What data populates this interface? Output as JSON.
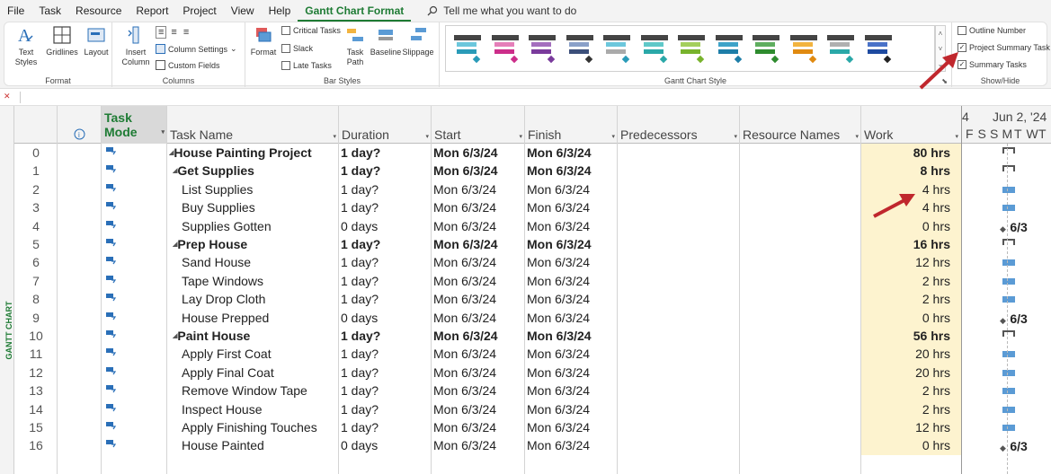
{
  "menu": {
    "items": [
      "File",
      "Task",
      "Resource",
      "Report",
      "Project",
      "View",
      "Help",
      "Gantt Chart Format"
    ],
    "active": "Gantt Chart Format",
    "tell_me": "Tell me what you want to do"
  },
  "ribbon": {
    "format_group": {
      "label": "Format",
      "text_styles": "Text Styles",
      "gridlines": "Gridlines",
      "layout": "Layout"
    },
    "columns_group": {
      "label": "Columns",
      "insert_column": "Insert Column",
      "column_settings": "Column Settings",
      "custom_fields": "Custom Fields"
    },
    "bar_styles_group": {
      "label": "Bar Styles",
      "format": "Format",
      "critical_tasks": "Critical Tasks",
      "slack": "Slack",
      "late_tasks": "Late Tasks",
      "task_path": "Task Path",
      "baseline": "Baseline",
      "slippage": "Slippage"
    },
    "gantt_style_group": {
      "label": "Gantt Chart Style"
    },
    "show_hide_group": {
      "label": "Show/Hide",
      "outline_number": "Outline Number",
      "project_summary_task": "Project Summary Task",
      "summary_tasks": "Summary Tasks",
      "outline_number_checked": false,
      "project_summary_checked": true,
      "summary_tasks_checked": true
    }
  },
  "gantt_styles": [
    {
      "top": "#6cc7dc",
      "bottom": "#2a9bb8",
      "diamond": "#2a9bb8"
    },
    {
      "top": "#e57fb9",
      "bottom": "#cc2e8a",
      "diamond": "#cc2e8a"
    },
    {
      "top": "#a46fbe",
      "bottom": "#7a3b9c",
      "diamond": "#7a3b9c"
    },
    {
      "top": "#8aa0c8",
      "bottom": "#3c4f7a",
      "diamond": "#333333"
    },
    {
      "top": "#6cc7dc",
      "bottom": "#aaaaaa",
      "diamond": "#2a9bb8"
    },
    {
      "top": "#5fc8c8",
      "bottom": "#2aa8a8",
      "diamond": "#2aa8a8"
    },
    {
      "top": "#a4cf5c",
      "bottom": "#78b32c",
      "diamond": "#78b32c"
    },
    {
      "top": "#3ea3c8",
      "bottom": "#1e7ea8",
      "diamond": "#1e7ea8"
    },
    {
      "top": "#5fae5f",
      "bottom": "#2e8b2e",
      "diamond": "#2e8b2e"
    },
    {
      "top": "#f2b440",
      "bottom": "#e08a10",
      "diamond": "#e08a10"
    },
    {
      "top": "#b0b0b0",
      "bottom": "#2aa8a8",
      "diamond": "#2aa8a8"
    },
    {
      "top": "#4a72c8",
      "bottom": "#1e4aa0",
      "diamond": "#222222"
    }
  ],
  "side_label": "GANTT CHART",
  "columns": {
    "task_mode": "Task Mode",
    "task_name": "Task Name",
    "duration": "Duration",
    "start": "Start",
    "finish": "Finish",
    "predecessors": "Predecessors",
    "resource_names": "Resource Names",
    "work": "Work"
  },
  "timescale": {
    "prev": "4",
    "week": "Jun 2, '24",
    "days": [
      "F",
      "S",
      "S",
      "M",
      "T",
      "W",
      "T"
    ]
  },
  "tasks": [
    {
      "id": "0",
      "name": "House Painting Project",
      "duration": "1 day?",
      "start": "Mon 6/3/24",
      "finish": "Mon 6/3/24",
      "work": "80 hrs",
      "bold": true,
      "summary": true,
      "indent": 0,
      "bar": "summary"
    },
    {
      "id": "1",
      "name": "Get Supplies",
      "duration": "1 day?",
      "start": "Mon 6/3/24",
      "finish": "Mon 6/3/24",
      "work": "8 hrs",
      "bold": true,
      "summary": true,
      "indent": 1,
      "bar": "summary"
    },
    {
      "id": "2",
      "name": "List Supplies",
      "duration": "1 day?",
      "start": "Mon 6/3/24",
      "finish": "Mon 6/3/24",
      "work": "4 hrs",
      "bold": false,
      "summary": false,
      "indent": 2,
      "bar": "task"
    },
    {
      "id": "3",
      "name": "Buy Supplies",
      "duration": "1 day?",
      "start": "Mon 6/3/24",
      "finish": "Mon 6/3/24",
      "work": "4 hrs",
      "bold": false,
      "summary": false,
      "indent": 2,
      "bar": "task"
    },
    {
      "id": "4",
      "name": "Supplies Gotten",
      "duration": "0 days",
      "start": "Mon 6/3/24",
      "finish": "Mon 6/3/24",
      "work": "0 hrs",
      "bold": false,
      "summary": false,
      "indent": 2,
      "bar": "milestone",
      "milestone_label": "6/3"
    },
    {
      "id": "5",
      "name": "Prep House",
      "duration": "1 day?",
      "start": "Mon 6/3/24",
      "finish": "Mon 6/3/24",
      "work": "16 hrs",
      "bold": true,
      "summary": true,
      "indent": 1,
      "bar": "summary"
    },
    {
      "id": "6",
      "name": "Sand House",
      "duration": "1 day?",
      "start": "Mon 6/3/24",
      "finish": "Mon 6/3/24",
      "work": "12 hrs",
      "bold": false,
      "summary": false,
      "indent": 2,
      "bar": "task"
    },
    {
      "id": "7",
      "name": "Tape Windows",
      "duration": "1 day?",
      "start": "Mon 6/3/24",
      "finish": "Mon 6/3/24",
      "work": "2 hrs",
      "bold": false,
      "summary": false,
      "indent": 2,
      "bar": "task"
    },
    {
      "id": "8",
      "name": "Lay Drop Cloth",
      "duration": "1 day?",
      "start": "Mon 6/3/24",
      "finish": "Mon 6/3/24",
      "work": "2 hrs",
      "bold": false,
      "summary": false,
      "indent": 2,
      "bar": "task"
    },
    {
      "id": "9",
      "name": "House Prepped",
      "duration": "0 days",
      "start": "Mon 6/3/24",
      "finish": "Mon 6/3/24",
      "work": "0 hrs",
      "bold": false,
      "summary": false,
      "indent": 2,
      "bar": "milestone",
      "milestone_label": "6/3"
    },
    {
      "id": "10",
      "name": "Paint House",
      "duration": "1 day?",
      "start": "Mon 6/3/24",
      "finish": "Mon 6/3/24",
      "work": "56 hrs",
      "bold": true,
      "summary": true,
      "indent": 1,
      "bar": "summary"
    },
    {
      "id": "11",
      "name": "Apply First Coat",
      "duration": "1 day?",
      "start": "Mon 6/3/24",
      "finish": "Mon 6/3/24",
      "work": "20 hrs",
      "bold": false,
      "summary": false,
      "indent": 2,
      "bar": "task"
    },
    {
      "id": "12",
      "name": "Apply Final Coat",
      "duration": "1 day?",
      "start": "Mon 6/3/24",
      "finish": "Mon 6/3/24",
      "work": "20 hrs",
      "bold": false,
      "summary": false,
      "indent": 2,
      "bar": "task"
    },
    {
      "id": "13",
      "name": "Remove Window Tape",
      "duration": "1 day?",
      "start": "Mon 6/3/24",
      "finish": "Mon 6/3/24",
      "work": "2 hrs",
      "bold": false,
      "summary": false,
      "indent": 2,
      "bar": "task"
    },
    {
      "id": "14",
      "name": "Inspect House",
      "duration": "1 day?",
      "start": "Mon 6/3/24",
      "finish": "Mon 6/3/24",
      "work": "2 hrs",
      "bold": false,
      "summary": false,
      "indent": 2,
      "bar": "task"
    },
    {
      "id": "15",
      "name": "Apply Finishing Touches",
      "duration": "1 day?",
      "start": "Mon 6/3/24",
      "finish": "Mon 6/3/24",
      "work": "12 hrs",
      "bold": false,
      "summary": false,
      "indent": 2,
      "bar": "task"
    },
    {
      "id": "16",
      "name": "House Painted",
      "duration": "0 days",
      "start": "Mon 6/3/24",
      "finish": "Mon 6/3/24",
      "work": "0 hrs",
      "bold": false,
      "summary": false,
      "indent": 2,
      "bar": "milestone",
      "milestone_label": "6/3"
    }
  ],
  "colors": {
    "accent": "#1e7b34",
    "work_highlight": "#fdf3cf",
    "task_bar": "#5b9bd5",
    "annotation_arrow": "#c0272d"
  }
}
